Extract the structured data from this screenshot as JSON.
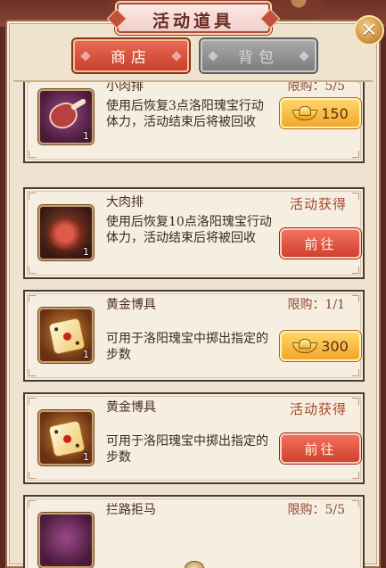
{
  "header": {
    "title": "活动道具"
  },
  "tabs": [
    {
      "label": "商店",
      "active": true
    },
    {
      "label": "背包",
      "active": false
    }
  ],
  "items": [
    {
      "name": "小肉排",
      "limit": "限购：5/5",
      "desc": "使用后恢复3点洛阳瑰宝行动体力，活动结束后将被回收",
      "count": "1",
      "price": "150",
      "icon": "meat-chop-icon"
    },
    {
      "name": "大肉排",
      "source": "活动获得",
      "desc": "使用后恢复10点洛阳瑰宝行动体力，活动结束后将被回收",
      "count": "1",
      "action": "前往",
      "icon": "ham-icon"
    },
    {
      "name": "黄金博具",
      "limit": "限购：1/1",
      "desc": "可用于洛阳瑰宝中掷出指定的步数",
      "count": "1",
      "price": "300",
      "icon": "golden-die-icon"
    },
    {
      "name": "黄金博具",
      "source": "活动获得",
      "desc": "可用于洛阳瑰宝中掷出指定的步数",
      "count": "1",
      "action": "前往",
      "icon": "golden-die-icon"
    },
    {
      "name": "拦路拒马",
      "limit": "限购：5/5"
    }
  ],
  "colors": {
    "accent_red": "#d2402e",
    "gold_button": "#f3a52a",
    "panel_bg": "#efe3d0"
  }
}
